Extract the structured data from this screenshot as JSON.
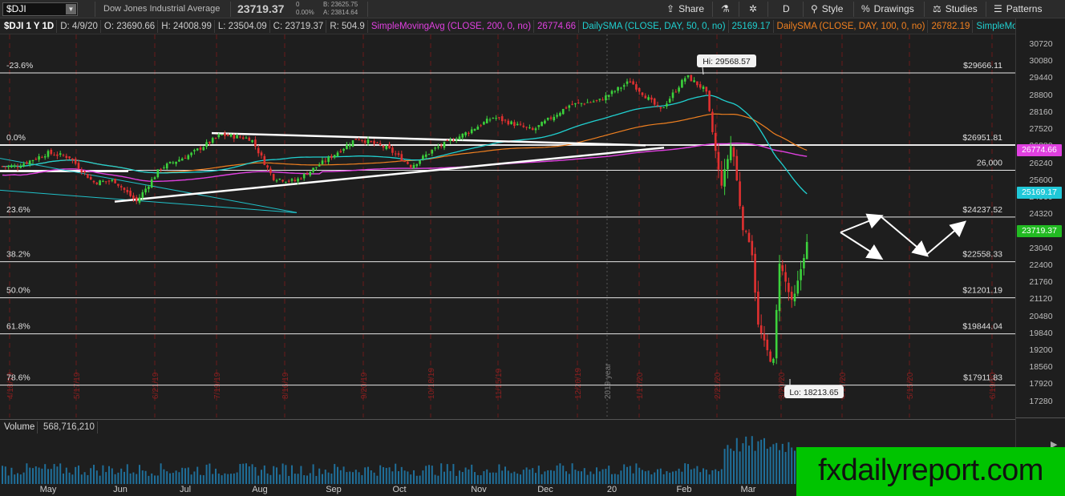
{
  "toolbar": {
    "symbol": "$DJI",
    "symbol_name": "Dow Jones Industrial Average",
    "last": "23719.37",
    "change": "0",
    "change_pct": "0.00%",
    "bid": "B: 23625.75",
    "ask": "A: 23814.64",
    "share_label": "Share",
    "period_label": "D",
    "style_label": "Style",
    "drawings_label": "Drawings",
    "studies_label": "Studies",
    "patterns_label": "Patterns"
  },
  "infobar": [
    {
      "text": "$DJI 1 Y 1D",
      "color": "#ffffff"
    },
    {
      "text": "D: 4/9/20",
      "color": "#cccccc"
    },
    {
      "text": "O: 23690.66",
      "color": "#cccccc"
    },
    {
      "text": "H: 24008.99",
      "color": "#cccccc"
    },
    {
      "text": "L: 23504.09",
      "color": "#cccccc"
    },
    {
      "text": "C: 23719.37",
      "color": "#cccccc"
    },
    {
      "text": "R: 504.9",
      "color": "#cccccc"
    },
    {
      "text": "SimpleMovingAvg (CLOSE, 200, 0, no)",
      "color": "#e040e0"
    },
    {
      "text": "26774.66",
      "color": "#e040e0"
    },
    {
      "text": "DailySMA (CLOSE, DAY, 50, 0, no)",
      "color": "#20d0d0"
    },
    {
      "text": "25169.17",
      "color": "#20d0d0"
    },
    {
      "text": "DailySMA (CLOSE, DAY, 100, 0, no)",
      "color": "#f08020"
    },
    {
      "text": "26782.19",
      "color": "#f08020"
    },
    {
      "text": "SimpleMoving...",
      "color": "#20d0d0"
    }
  ],
  "price_ticks": [
    "30720",
    "30080",
    "29440",
    "28800",
    "28160",
    "27520",
    "26880",
    "26240",
    "25600",
    "24960",
    "24320",
    "23680",
    "23040",
    "22400",
    "21760",
    "21120",
    "20480",
    "19840",
    "19200",
    "18560",
    "17920",
    "17280"
  ],
  "fib_levels": [
    {
      "pct": "-23.6%",
      "price": "$29666.11",
      "value": 29666.11
    },
    {
      "pct": "0.0%",
      "price": "$26951.81",
      "value": 26951.81
    },
    {
      "pct": "",
      "price": "26,000",
      "value": 26000
    },
    {
      "pct": "23.6%",
      "price": "$24237.52",
      "value": 24237.52
    },
    {
      "pct": "38.2%",
      "price": "$22558.33",
      "value": 22558.33
    },
    {
      "pct": "50.0%",
      "price": "$21201.19",
      "value": 21201.19
    },
    {
      "pct": "61.8%",
      "price": "$19844.04",
      "value": 19844.04
    },
    {
      "pct": "78.6%",
      "price": "$17911.83",
      "value": 17911.83
    }
  ],
  "price_tags": [
    {
      "text": "26774.66",
      "value": 26774.66,
      "bg": "#e040e0",
      "fg": "#ffffff"
    },
    {
      "text": "25169.17",
      "value": 25169.17,
      "bg": "#20c8d8",
      "fg": "#ffffff"
    },
    {
      "text": "23719.37",
      "value": 23719.37,
      "bg": "#22bb22",
      "fg": "#ffffff"
    }
  ],
  "hi_label": "Hi: 29568.57",
  "lo_label": "Lo: 18213.65",
  "year_label": "2019 year",
  "expiry_dates": [
    "4/18/19",
    "5/17/19",
    "6/21/19",
    "7/19/19",
    "8/16/19",
    "9/20/19",
    "10/18/19",
    "11/15/19",
    "12/20/19",
    "1/17/20",
    "2/21/20",
    "3/20/20",
    "4/17/20",
    "5/15/20",
    "6/19/20"
  ],
  "months": [
    "May",
    "Jun",
    "Jul",
    "Aug",
    "Sep",
    "Oct",
    "Nov",
    "Dec",
    "20",
    "Feb",
    "Mar"
  ],
  "volume": {
    "label": "Volume",
    "value": "568,716,210"
  },
  "watermark": "fxdailyreport.com",
  "chart_data": {
    "type": "candlestick",
    "title": "Dow Jones Industrial Average",
    "symbol": "$DJI",
    "period": "1 Y 1D",
    "last_bar": {
      "date": "4/9/20",
      "open": 23690.66,
      "high": 24008.99,
      "low": 23504.09,
      "close": 23719.37,
      "range": 504.9
    },
    "ylim": [
      17000,
      31000
    ],
    "x_range": [
      "2019-04",
      "2020-06"
    ],
    "close_path": [
      {
        "t": "2019-04-09",
        "c": 26150
      },
      {
        "t": "2019-04-23",
        "c": 26650
      },
      {
        "t": "2019-05-03",
        "c": 26500
      },
      {
        "t": "2019-05-14",
        "c": 25550
      },
      {
        "t": "2019-05-24",
        "c": 25600
      },
      {
        "t": "2019-06-03",
        "c": 24820
      },
      {
        "t": "2019-06-14",
        "c": 26080
      },
      {
        "t": "2019-06-28",
        "c": 26600
      },
      {
        "t": "2019-07-12",
        "c": 27330
      },
      {
        "t": "2019-07-26",
        "c": 27190
      },
      {
        "t": "2019-08-05",
        "c": 25720
      },
      {
        "t": "2019-08-15",
        "c": 25580
      },
      {
        "t": "2019-08-30",
        "c": 26400
      },
      {
        "t": "2019-09-13",
        "c": 27220
      },
      {
        "t": "2019-09-27",
        "c": 26820
      },
      {
        "t": "2019-10-08",
        "c": 26160
      },
      {
        "t": "2019-10-18",
        "c": 26770
      },
      {
        "t": "2019-11-01",
        "c": 27350
      },
      {
        "t": "2019-11-15",
        "c": 28000
      },
      {
        "t": "2019-12-03",
        "c": 27500
      },
      {
        "t": "2019-12-20",
        "c": 28450
      },
      {
        "t": "2020-01-03",
        "c": 28630
      },
      {
        "t": "2020-01-17",
        "c": 29350
      },
      {
        "t": "2020-01-31",
        "c": 28250
      },
      {
        "t": "2020-02-12",
        "c": 29550
      },
      {
        "t": "2020-02-21",
        "c": 28990
      },
      {
        "t": "2020-02-28",
        "c": 25400
      },
      {
        "t": "2020-03-04",
        "c": 27090
      },
      {
        "t": "2020-03-09",
        "c": 23850
      },
      {
        "t": "2020-03-13",
        "c": 23190
      },
      {
        "t": "2020-03-16",
        "c": 20190
      },
      {
        "t": "2020-03-23",
        "c": 18590
      },
      {
        "t": "2020-03-26",
        "c": 22550
      },
      {
        "t": "2020-04-01",
        "c": 20940
      },
      {
        "t": "2020-04-06",
        "c": 22680
      },
      {
        "t": "2020-04-09",
        "c": 23719
      }
    ],
    "series": [
      {
        "name": "SimpleMovingAvg (CLOSE, 200, 0, no)",
        "last": 26774.66,
        "color": "#e040e0"
      },
      {
        "name": "DailySMA (CLOSE, DAY, 50, 0, no)",
        "last": 25169.17,
        "color": "#20d0d0"
      },
      {
        "name": "DailySMA (CLOSE, DAY, 100, 0, no)",
        "last": 26782.19,
        "color": "#f08020"
      }
    ],
    "annotations": [
      "Hi: 29568.57",
      "Lo: 18213.65"
    ]
  }
}
